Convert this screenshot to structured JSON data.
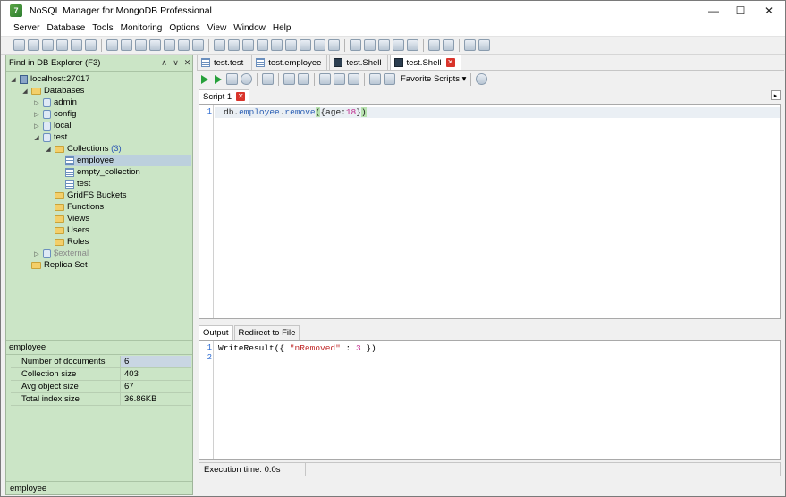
{
  "window": {
    "title": "NoSQL Manager for MongoDB Professional",
    "minimize": "—",
    "maximize": "☐",
    "close": "✕"
  },
  "menu": [
    "Server",
    "Database",
    "Tools",
    "Monitoring",
    "Options",
    "View",
    "Window",
    "Help"
  ],
  "left": {
    "find_label": "Find in DB Explorer (F3)",
    "tree": {
      "server": "localhost:27017",
      "databases": "Databases",
      "db_admin": "admin",
      "db_config": "config",
      "db_local": "local",
      "db_test": "test",
      "collections_label": "Collections",
      "collections_count": "(3)",
      "coll_employee": "employee",
      "coll_empty": "empty_collection",
      "coll_test": "test",
      "gridfs": "GridFS Buckets",
      "functions": "Functions",
      "views": "Views",
      "users": "Users",
      "roles": "Roles",
      "external": "$external",
      "replica": "Replica Set"
    },
    "props_title": "employee",
    "props": [
      {
        "key": "Number of documents",
        "value": "6"
      },
      {
        "key": "Collection size",
        "value": "403"
      },
      {
        "key": "Avg object size",
        "value": "67"
      },
      {
        "key": "Total index size",
        "value": "36.86KB"
      }
    ],
    "status": "employee"
  },
  "tabs": [
    {
      "label": "test.test"
    },
    {
      "label": "test.employee"
    },
    {
      "label": "test.Shell"
    },
    {
      "label": "test.Shell"
    }
  ],
  "script_toolbar": {
    "favorite": "Favorite Scripts"
  },
  "script_tab": "Script 1",
  "editor": {
    "line_numbers": [
      "1"
    ],
    "code_obj": "db",
    "code_dot1": ".",
    "code_coll": "employee",
    "code_dot2": ".",
    "code_method": "remove",
    "code_open": "(",
    "code_brace_open": "{",
    "code_key": "age",
    "code_colon": ":",
    "code_num": "18",
    "code_brace_close": "}",
    "code_close": ")"
  },
  "output": {
    "tabs": [
      "Output",
      "Redirect to File"
    ],
    "line_numbers": [
      "1",
      "2"
    ],
    "result_prefix": "WriteResult({ ",
    "result_key": "\"nRemoved\"",
    "result_sep": " : ",
    "result_num": "3",
    "result_suffix": " })"
  },
  "status": {
    "exec_time": "Execution time: 0.0s"
  }
}
